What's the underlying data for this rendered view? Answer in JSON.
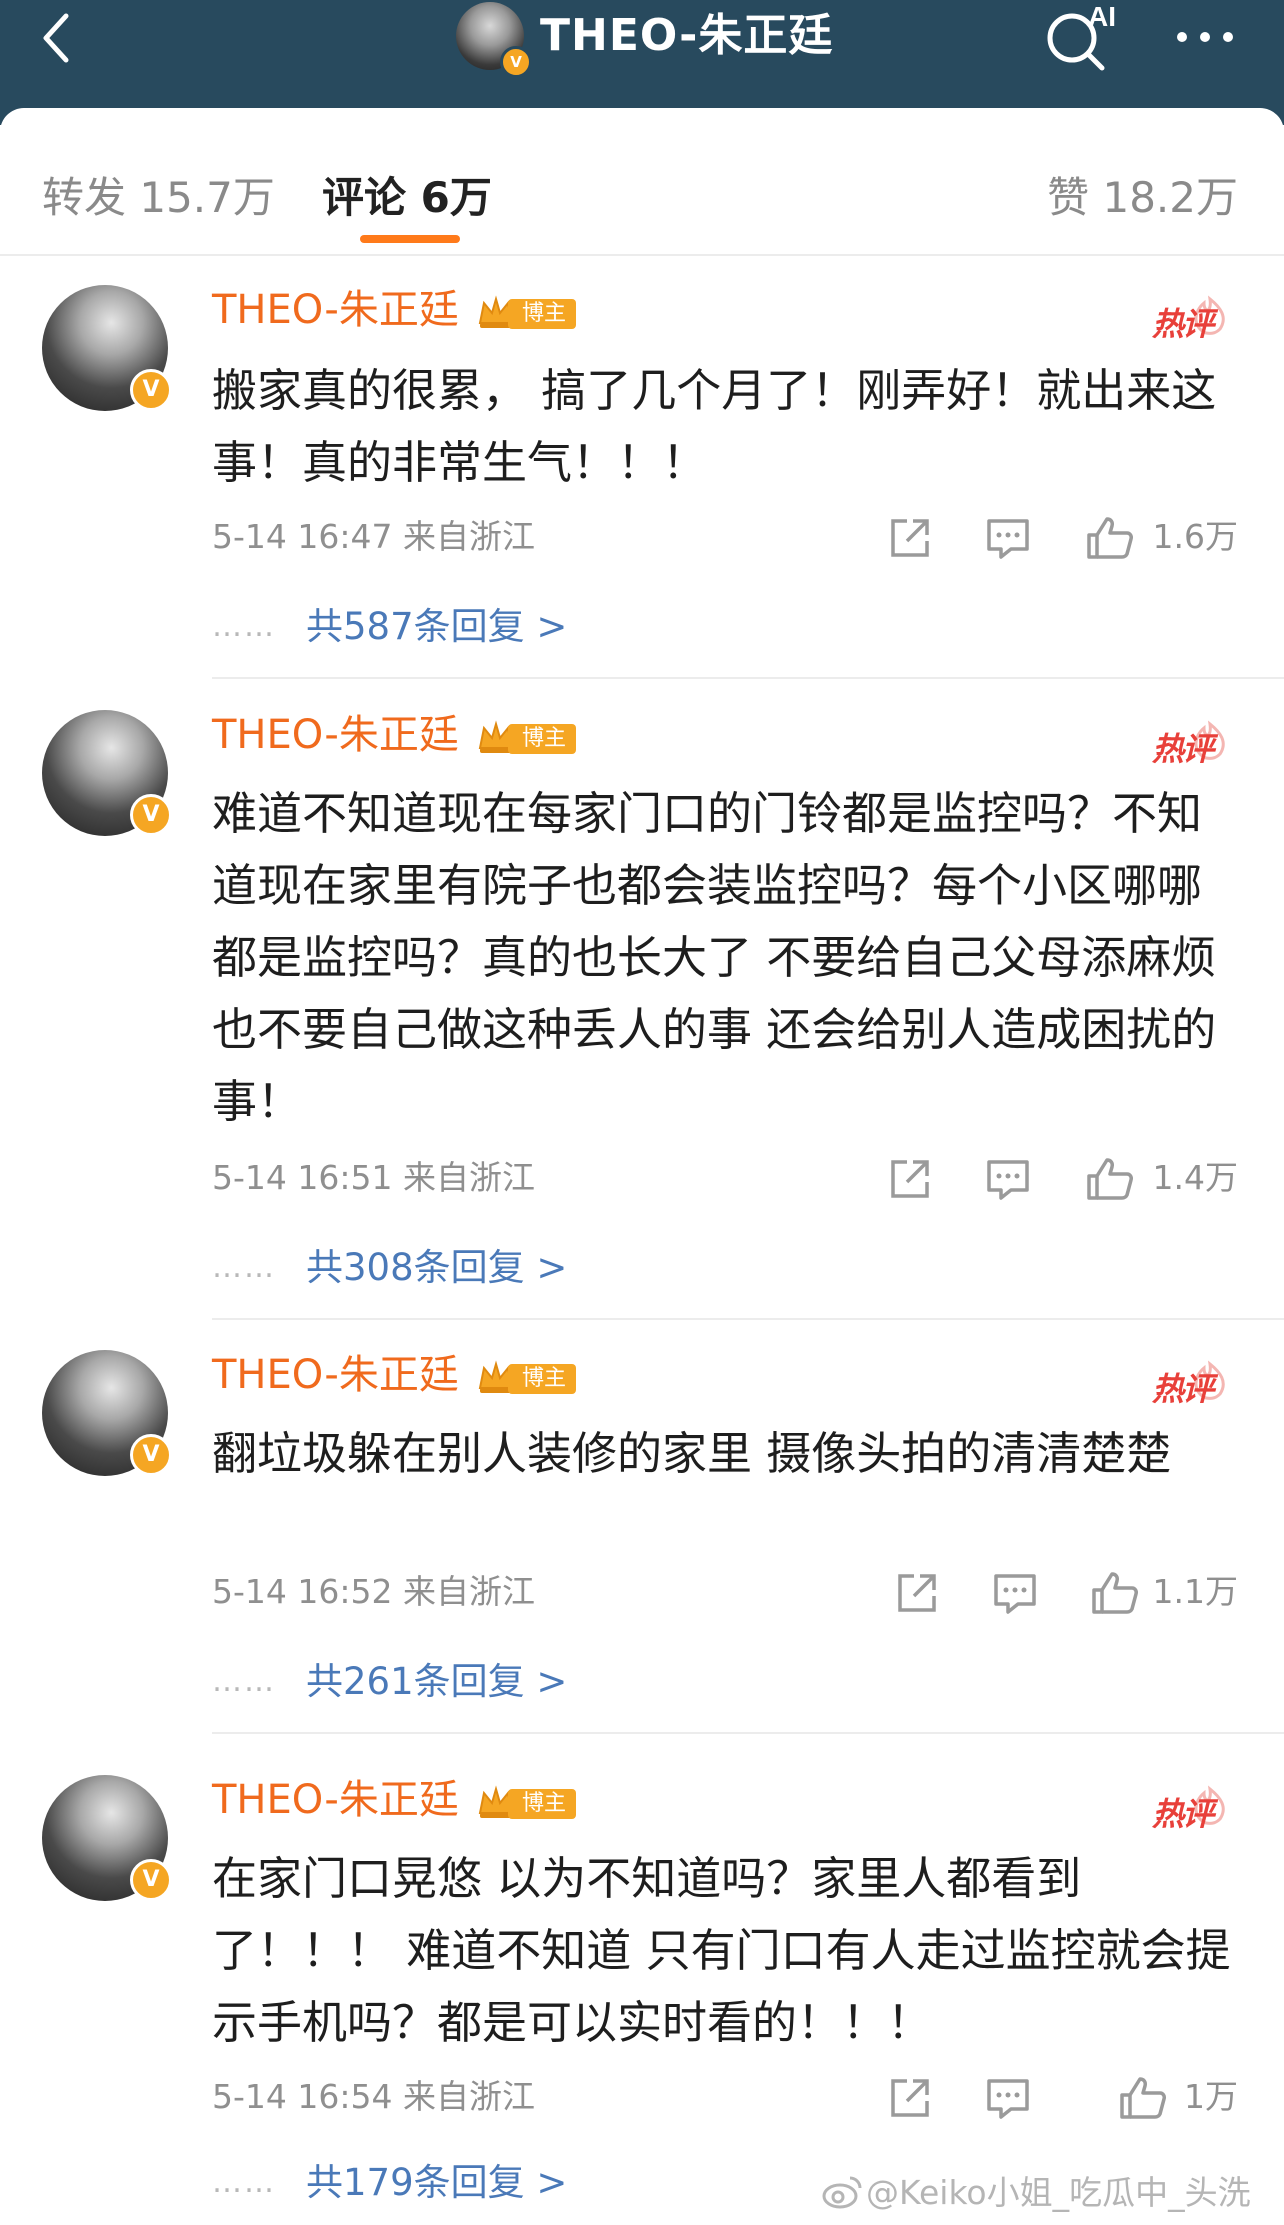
{
  "header": {
    "title": "THEO-朱正廷",
    "back_icon": "chevron-left-icon",
    "search_icon": "ai-search-icon",
    "search_label": "AI",
    "more_icon": "more-horizontal-icon",
    "background": "#284a5e"
  },
  "tabs": [
    {
      "label": "转发 15.7万",
      "active": false
    },
    {
      "label": "评论 6万",
      "active": true
    },
    {
      "label": "赞 18.2万",
      "active": false
    }
  ],
  "accent_color": "#ff7a1a",
  "comments": [
    {
      "username": "THEO-朱正廷",
      "badge": "博主",
      "hot_label": "热评",
      "text": "搬家真的很累， 搞了几个月了！刚弄好！就出来这事！真的非常生气！！！",
      "time": "5-14 16:47  来自浙江",
      "likes": "1.6万",
      "replies": "共587条回复 >"
    },
    {
      "username": "THEO-朱正廷",
      "badge": "博主",
      "hot_label": "热评",
      "text": "难道不知道现在每家门口的门铃都是监控吗？不知道现在家里有院子也都会装监控吗？每个小区哪哪都是监控吗？真的也长大了 不要给自己父母添麻烦 也不要自己做这种丢人的事 还会给别人造成困扰的事！",
      "time": "5-14 16:51  来自浙江",
      "likes": "1.4万",
      "replies": "共308条回复 >"
    },
    {
      "username": "THEO-朱正廷",
      "badge": "博主",
      "hot_label": "热评",
      "text": "翻垃圾躲在别人装修的家里 摄像头拍的清清楚楚",
      "time": "5-14 16:52  来自浙江",
      "likes": "1.1万",
      "replies": "共261条回复 >"
    },
    {
      "username": "THEO-朱正廷",
      "badge": "博主",
      "hot_label": "热评",
      "text": "在家门口晃悠 以为不知道吗？家里人都看到了！！！ 难道不知道 只有门口有人走过监控就会提示手机吗？都是可以实时看的！！！",
      "time": "5-14 16:54  来自浙江",
      "likes": "1万",
      "replies": "共179条回复 >"
    }
  ],
  "reply_dots": "……",
  "watermark": "@Keiko小姐_吃瓜中_头洗"
}
